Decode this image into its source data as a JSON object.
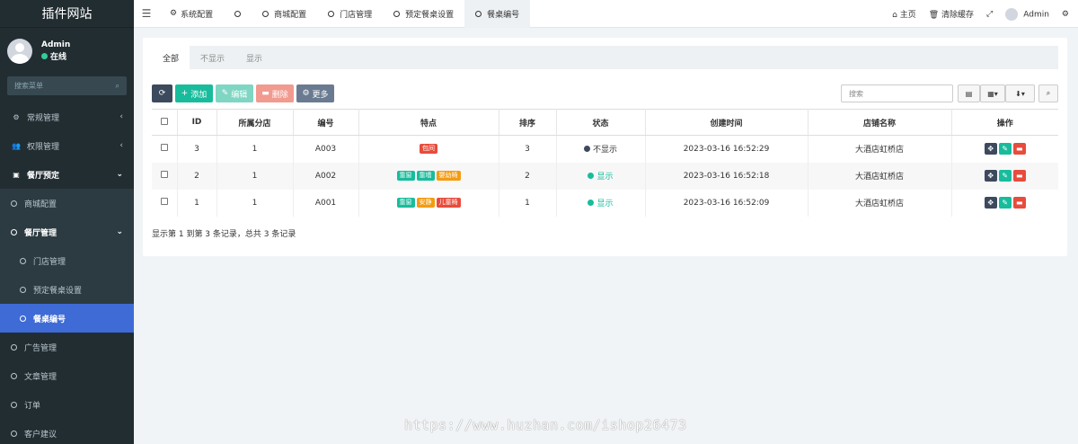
{
  "sidebar": {
    "logo": "插件网站",
    "user": {
      "name": "Admin",
      "status": "在线"
    },
    "search_placeholder": "搜索菜单",
    "items": [
      {
        "label": "常规管理"
      },
      {
        "label": "权限管理"
      },
      {
        "label": "餐厅预定"
      },
      {
        "label": "商城配置"
      },
      {
        "label": "餐厅管理"
      },
      {
        "label": "门店管理"
      },
      {
        "label": "预定餐桌设置"
      },
      {
        "label": "餐桌编号"
      },
      {
        "label": "广告管理"
      },
      {
        "label": "文章管理"
      },
      {
        "label": "订单"
      },
      {
        "label": "客户建议"
      }
    ]
  },
  "topbar": {
    "tabs": [
      {
        "label": "系统配置"
      },
      {
        "label": ""
      },
      {
        "label": "商城配置"
      },
      {
        "label": "门店管理"
      },
      {
        "label": "预定餐桌设置"
      },
      {
        "label": "餐桌编号"
      }
    ],
    "home": "主页",
    "clear_cache": "清除缓存",
    "user": "Admin"
  },
  "filter_tabs": [
    "全部",
    "不显示",
    "显示"
  ],
  "toolbar": {
    "add": "添加",
    "edit": "编辑",
    "delete": "删除",
    "more": "更多",
    "search_placeholder": "搜索"
  },
  "table": {
    "headers": [
      "ID",
      "所属分店",
      "编号",
      "特点",
      "排序",
      "状态",
      "创建时间",
      "店铺名称",
      "操作"
    ],
    "rows": [
      {
        "id": "3",
        "branch": "1",
        "code": "A003",
        "tags": [
          {
            "text": "包间",
            "color": "#e74c3c"
          }
        ],
        "sort": "3",
        "status": "不显示",
        "status_color": "#3d4a5d",
        "created": "2023-03-16 16:52:29",
        "shop": "大酒店虹桥店"
      },
      {
        "id": "2",
        "branch": "1",
        "code": "A002",
        "tags": [
          {
            "text": "靠窗",
            "color": "#18bc9c"
          },
          {
            "text": "靠墙",
            "color": "#18bc9c"
          },
          {
            "text": "婴幼椅",
            "color": "#f39c12"
          }
        ],
        "sort": "2",
        "status": "显示",
        "status_color": "#18bc9c",
        "created": "2023-03-16 16:52:18",
        "shop": "大酒店虹桥店"
      },
      {
        "id": "1",
        "branch": "1",
        "code": "A001",
        "tags": [
          {
            "text": "靠窗",
            "color": "#18bc9c"
          },
          {
            "text": "安静",
            "color": "#f39c12"
          },
          {
            "text": "儿童椅",
            "color": "#e74c3c"
          }
        ],
        "sort": "1",
        "status": "显示",
        "status_color": "#18bc9c",
        "created": "2023-03-16 16:52:09",
        "shop": "大酒店虹桥店"
      }
    ]
  },
  "summary": "显示第 1 到第 3 条记录，总共 3 条记录",
  "watermark": "https://www.huzhan.com/ishop26473",
  "colors": {
    "sidebar_bg": "#222d32",
    "active": "#3e6bd5",
    "success": "#18bc9c",
    "danger": "#e74c3c",
    "dark": "#3d4a5d"
  }
}
